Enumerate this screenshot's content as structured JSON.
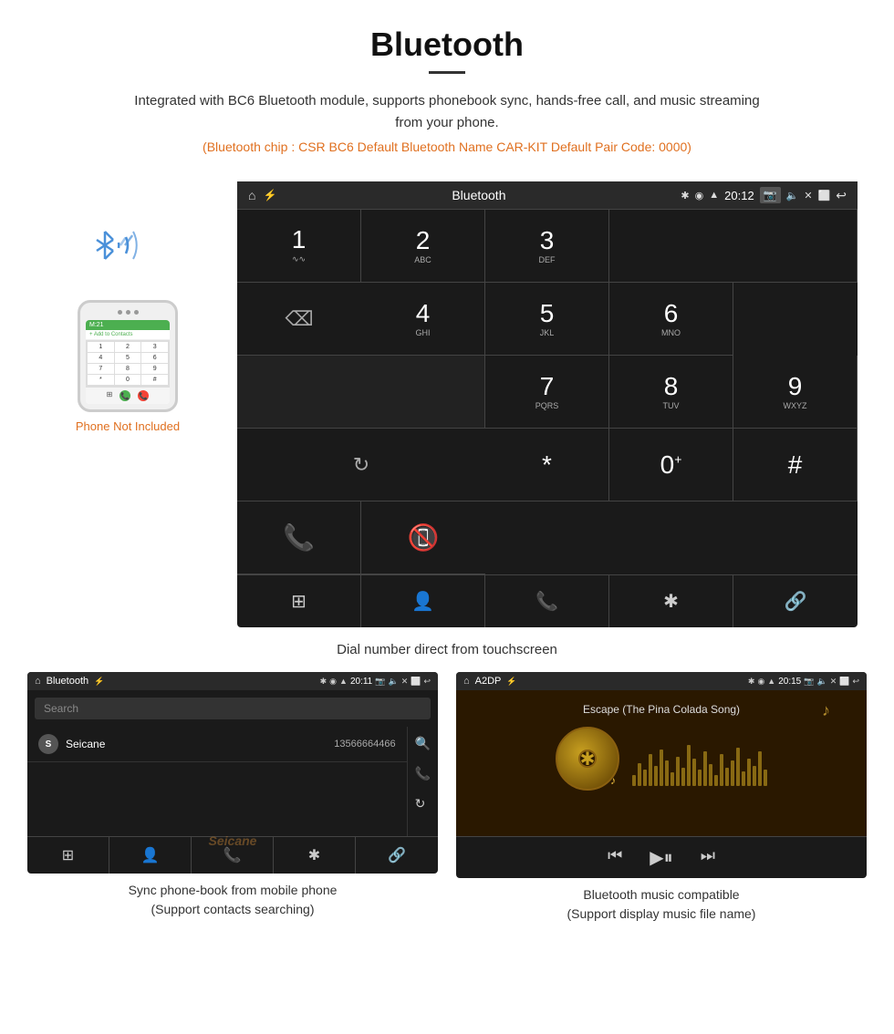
{
  "header": {
    "title": "Bluetooth",
    "description": "Integrated with BC6 Bluetooth module, supports phonebook sync, hands-free call, and music streaming from your phone.",
    "specs": "(Bluetooth chip : CSR BC6    Default Bluetooth Name CAR-KIT    Default Pair Code: 0000)"
  },
  "phone_mockup": {
    "not_included_label": "Phone Not Included",
    "green_bar_text": "M:21",
    "add_contacts": "+ Add to Contacts",
    "keys": [
      "1",
      "2",
      "3",
      "4",
      "5",
      "6",
      "7",
      "8",
      "9",
      "*",
      "0",
      "#"
    ]
  },
  "dial_screen": {
    "topbar_title": "Bluetooth",
    "time": "20:12",
    "keys": [
      {
        "number": "1",
        "letters": "∿∿"
      },
      {
        "number": "2",
        "letters": "ABC"
      },
      {
        "number": "3",
        "letters": "DEF"
      },
      {
        "number": "4",
        "letters": "GHI"
      },
      {
        "number": "5",
        "letters": "JKL"
      },
      {
        "number": "6",
        "letters": "MNO"
      },
      {
        "number": "7",
        "letters": "PQRS"
      },
      {
        "number": "8",
        "letters": "TUV"
      },
      {
        "number": "9",
        "letters": "WXYZ"
      },
      {
        "number": "*",
        "letters": ""
      },
      {
        "number": "0",
        "letters": "+"
      },
      {
        "number": "#",
        "letters": ""
      }
    ]
  },
  "dial_caption": "Dial number direct from touchscreen",
  "phonebook_screen": {
    "topbar_title": "Bluetooth",
    "time": "20:11",
    "search_placeholder": "Search",
    "contact_name": "Seicane",
    "contact_letter": "S",
    "contact_number": "13566664466"
  },
  "music_screen": {
    "topbar_title": "A2DP",
    "time": "20:15",
    "song_title": "Escape (The Pina Colada Song)"
  },
  "captions": {
    "phonebook": "Sync phone-book from mobile phone",
    "phonebook_sub": "(Support contacts searching)",
    "music": "Bluetooth music compatible",
    "music_sub": "(Support display music file name)"
  },
  "eq_bars": [
    12,
    25,
    18,
    35,
    22,
    40,
    28,
    15,
    32,
    20,
    45,
    30,
    18,
    38,
    24,
    12,
    35,
    20,
    28,
    42,
    16,
    30,
    22,
    38,
    18
  ]
}
